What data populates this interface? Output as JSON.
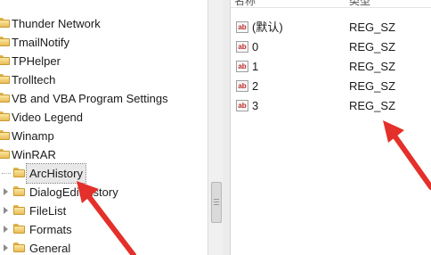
{
  "tree": {
    "items": [
      {
        "label": "Thunder Network",
        "level": 0,
        "selected": false
      },
      {
        "label": "TmailNotify",
        "level": 0,
        "selected": false
      },
      {
        "label": "TPHelper",
        "level": 0,
        "selected": false
      },
      {
        "label": "Trolltech",
        "level": 0,
        "selected": false
      },
      {
        "label": "VB and VBA Program Settings",
        "level": 0,
        "selected": false
      },
      {
        "label": "Video Legend",
        "level": 0,
        "selected": false
      },
      {
        "label": "Winamp",
        "level": 0,
        "selected": false
      },
      {
        "label": "WinRAR",
        "level": 0,
        "selected": false
      },
      {
        "label": "ArcHistory",
        "level": 1,
        "selected": true
      },
      {
        "label": "DialogEditHistory",
        "level": 1,
        "selected": false
      },
      {
        "label": "FileList",
        "level": 1,
        "selected": false
      },
      {
        "label": "Formats",
        "level": 1,
        "selected": false
      },
      {
        "label": "General",
        "level": 1,
        "selected": false
      }
    ]
  },
  "values": {
    "header_name": "名称",
    "header_type": "类型",
    "rows": [
      {
        "name": "(默认)",
        "type": "REG_SZ",
        "icon": "ab-string-icon"
      },
      {
        "name": "0",
        "type": "REG_SZ",
        "icon": "ab-string-icon"
      },
      {
        "name": "1",
        "type": "REG_SZ",
        "icon": "ab-string-icon"
      },
      {
        "name": "2",
        "type": "REG_SZ",
        "icon": "ab-string-icon"
      },
      {
        "name": "3",
        "type": "REG_SZ",
        "icon": "ab-string-icon"
      }
    ],
    "icon_text": "ab"
  },
  "colors": {
    "arrow": "#e4302a",
    "folder": "#f0c867"
  }
}
